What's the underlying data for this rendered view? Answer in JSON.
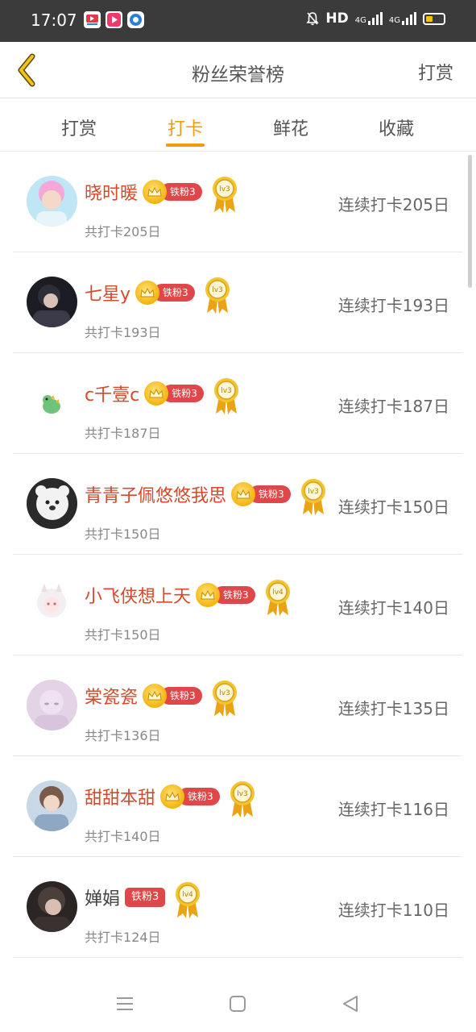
{
  "status": {
    "time": "17:07",
    "network": "HD",
    "sig1": "4G",
    "sig2": "4G"
  },
  "header": {
    "title": "粉丝荣誉榜",
    "action": "打赏"
  },
  "tabs": [
    {
      "label": "打赏"
    },
    {
      "label": "打卡"
    },
    {
      "label": "鲜花"
    },
    {
      "label": "收藏"
    }
  ],
  "active_tab": "打卡",
  "colors": {
    "accent": "#f29b10",
    "name_red": "#d44a2a",
    "badge_red": "#e0474a"
  },
  "rows": [
    {
      "name": "晓时暖",
      "badge": "铁粉3",
      "level": "lv3",
      "total": "共打卡205日",
      "streak": "连续打卡205日"
    },
    {
      "name": "七星y",
      "badge": "铁粉3",
      "level": "lv3",
      "total": "共打卡193日",
      "streak": "连续打卡193日"
    },
    {
      "name": "c千壹c",
      "badge": "铁粉3",
      "level": "lv3",
      "total": "共打卡187日",
      "streak": "连续打卡187日"
    },
    {
      "name": "青青子佩悠悠我思",
      "badge": "铁粉3",
      "level": "lv3",
      "total": "共打卡150日",
      "streak": "连续打卡150日"
    },
    {
      "name": "小飞侠想上天",
      "badge": "铁粉3",
      "level": "lv4",
      "total": "共打卡150日",
      "streak": "连续打卡140日"
    },
    {
      "name": "棠瓷瓷",
      "badge": "铁粉3",
      "level": "lv3",
      "total": "共打卡136日",
      "streak": "连续打卡135日"
    },
    {
      "name": "甜甜本甜",
      "badge": "铁粉3",
      "level": "lv3",
      "total": "共打卡140日",
      "streak": "连续打卡116日"
    },
    {
      "name": "婵娟",
      "badge": "铁粉3",
      "level": "lv4",
      "total": "共打卡124日",
      "streak": "连续打卡110日"
    }
  ]
}
